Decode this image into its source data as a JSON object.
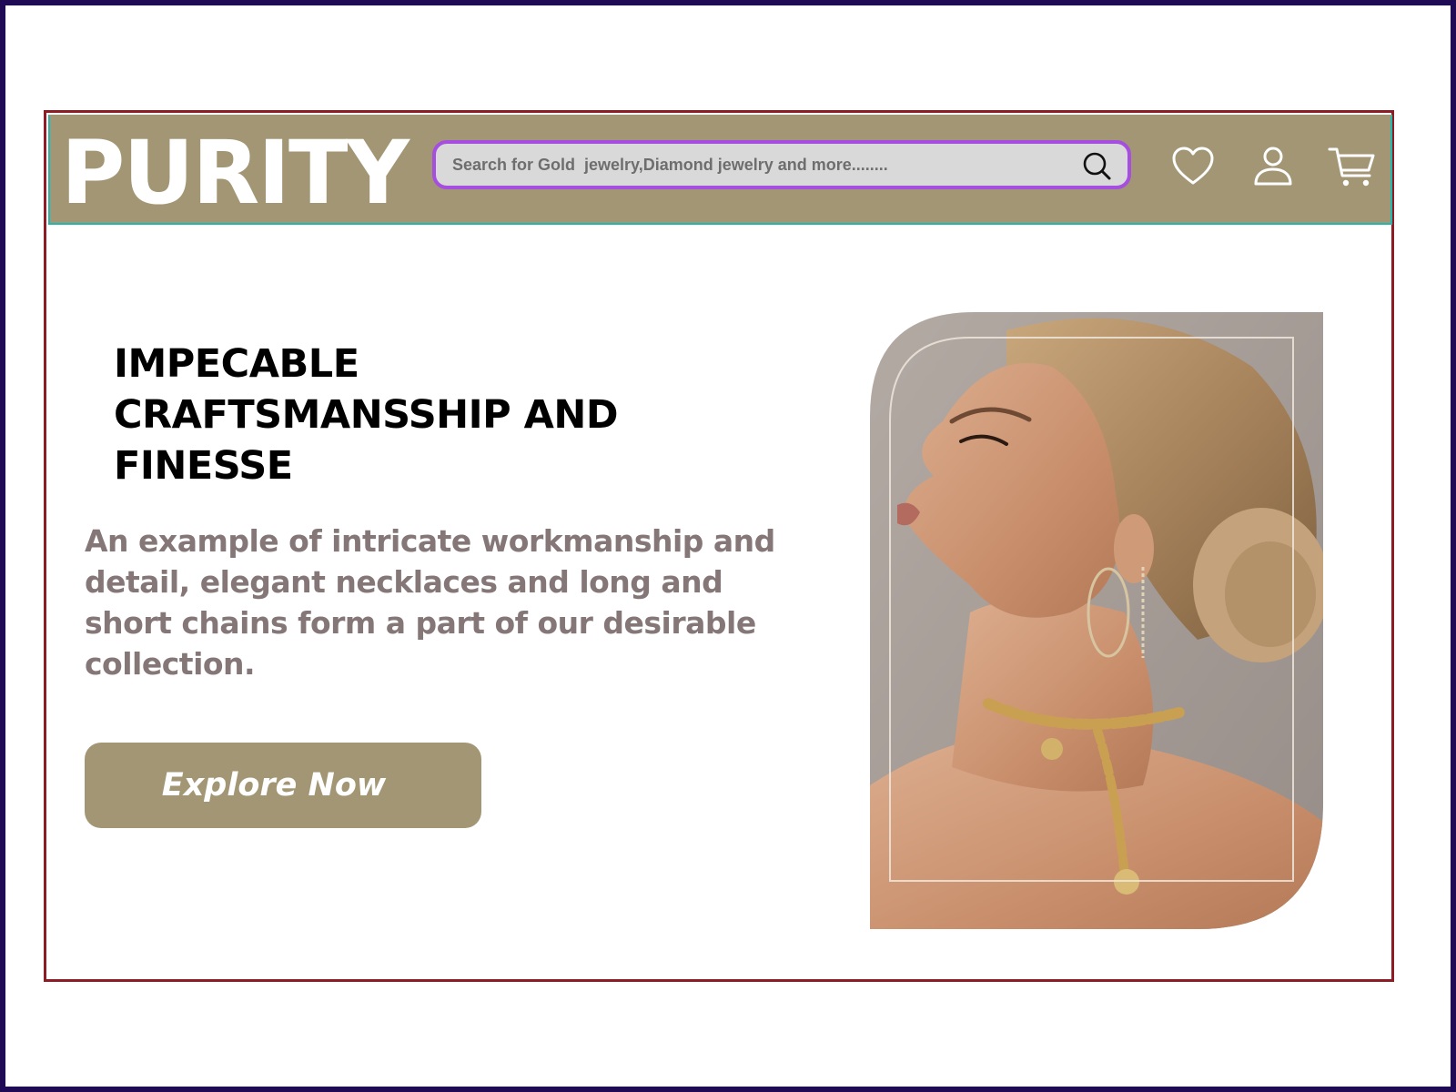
{
  "header": {
    "logo": "PURITY",
    "search": {
      "placeholder": "Search for Gold  jewelry,Diamond jewelry and more........",
      "value": ""
    },
    "icons": [
      "heart-icon",
      "user-icon",
      "cart-icon"
    ]
  },
  "hero": {
    "title": "IMPECABLE CRAFTSMANSSHIP AND FINESSE",
    "description": "An example of intricate workmanship and detail, elegant necklaces and long and short chains form a part of our desirable collection.",
    "cta_label": "Explore Now",
    "image_alt": "Model in profile wearing gold hoop earrings, ear cuffs and a chunky gold chain necklace"
  },
  "colors": {
    "brand": "#a39674",
    "search_border": "#a64ee0",
    "search_bg": "#d9d9d9",
    "description_text": "#857777",
    "frame_border": "#8e1c24",
    "outer_border": "#1e0a55",
    "header_border": "#1fb8b0"
  }
}
